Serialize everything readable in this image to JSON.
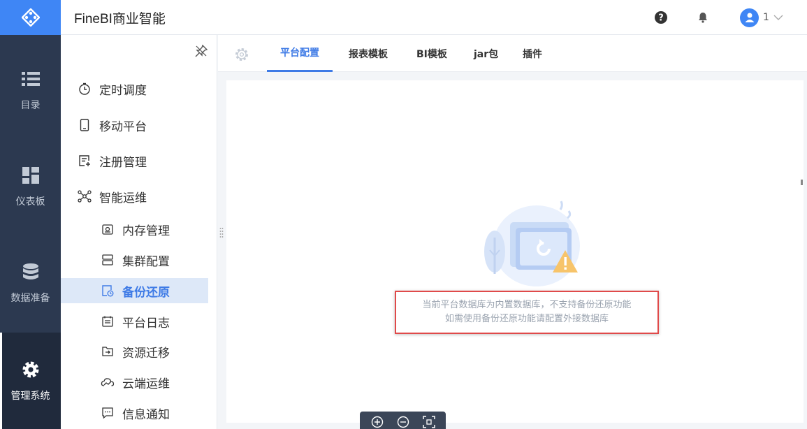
{
  "app": {
    "title": "FineBI商业智能"
  },
  "colors": {
    "accent": "#3f7be6",
    "rail_bg": "#2c3950",
    "logo_bg": "#3f86f5",
    "highlight_border": "#e04a4a"
  },
  "rail": {
    "items": [
      {
        "label": "目录",
        "icon": "list-icon"
      },
      {
        "label": "仪表板",
        "icon": "dashboard-icon"
      },
      {
        "label": "数据准备",
        "icon": "database-icon"
      },
      {
        "label": "管理系统",
        "icon": "gear-icon",
        "active": true
      }
    ]
  },
  "header": {
    "user_name": "1",
    "icons": [
      "help-icon",
      "bell-icon",
      "user-avatar-icon",
      "chevron-down-icon"
    ]
  },
  "sidebar": {
    "items": [
      {
        "label": "定时调度",
        "icon": "timer-icon"
      },
      {
        "label": "移动平台",
        "icon": "mobile-icon"
      },
      {
        "label": "注册管理",
        "icon": "register-icon"
      },
      {
        "label": "智能运维",
        "icon": "network-icon"
      },
      {
        "label": "内存管理",
        "icon": "memory-icon"
      },
      {
        "label": "集群配置",
        "icon": "cluster-icon"
      },
      {
        "label": "备份还原",
        "icon": "backup-icon",
        "selected": true
      },
      {
        "label": "平台日志",
        "icon": "log-icon"
      },
      {
        "label": "资源迁移",
        "icon": "migrate-icon"
      },
      {
        "label": "云端运维",
        "icon": "cloud-ops-icon"
      },
      {
        "label": "信息通知",
        "icon": "message-icon"
      }
    ]
  },
  "tabs": [
    {
      "label": "平台配置",
      "active": true
    },
    {
      "label": "报表模板"
    },
    {
      "label": "BI模板"
    },
    {
      "label": "jar包"
    },
    {
      "label": "插件"
    }
  ],
  "empty_state": {
    "line1": "当前平台数据库为内置数据库，不支持备份还原功能",
    "line2": "如需使用备份还原功能请配置外接数据库"
  }
}
